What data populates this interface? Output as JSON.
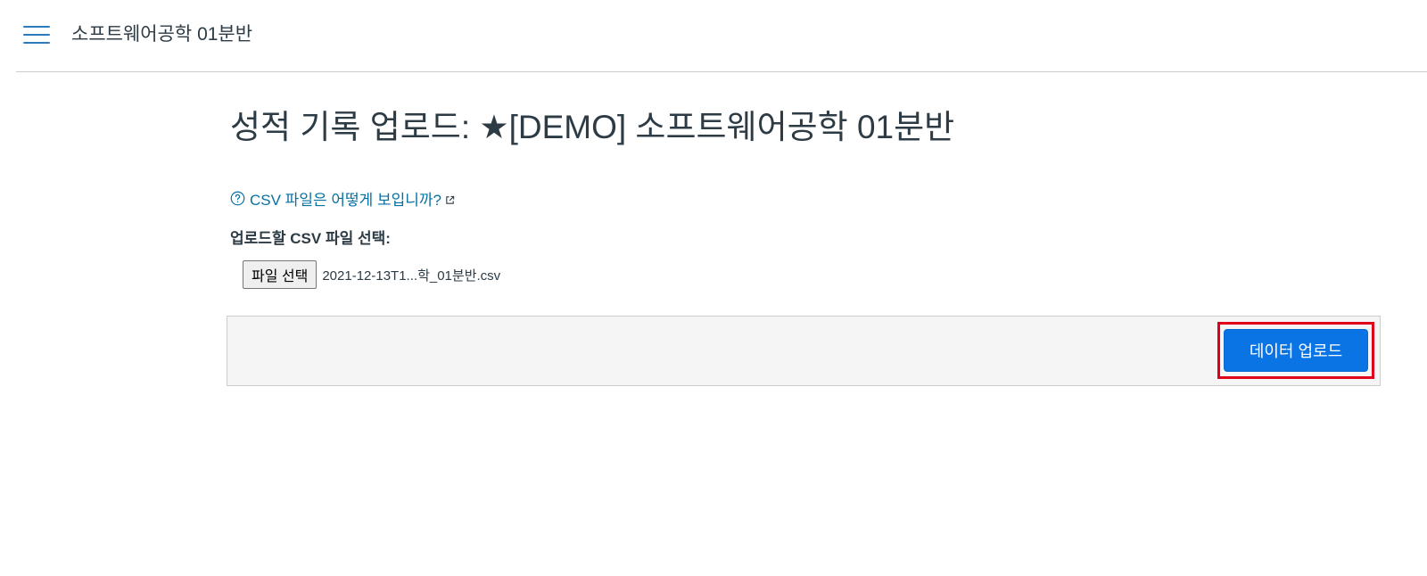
{
  "header": {
    "course_name": "소프트웨어공학 01분반",
    "menu_icon": "hamburger-menu-icon"
  },
  "main": {
    "title": "성적 기록 업로드: ★[DEMO] 소프트웨어공학 01분반",
    "help_link": {
      "label": "CSV 파일은 어떻게 보입니까?",
      "icon": "question-circle-icon",
      "trailing_icon": "external-link-icon"
    },
    "file_section": {
      "label": "업로드할 CSV 파일 선택:",
      "button_label": "파일 선택",
      "selected_file": "2021-12-13T1...학_01분반.csv"
    },
    "actions": {
      "upload_label": "데이터 업로드"
    }
  },
  "colors": {
    "link": "#0770a3",
    "primary_button": "#0b74e5",
    "highlight": "#e0001a",
    "menu_icon": "#2b7abc"
  }
}
